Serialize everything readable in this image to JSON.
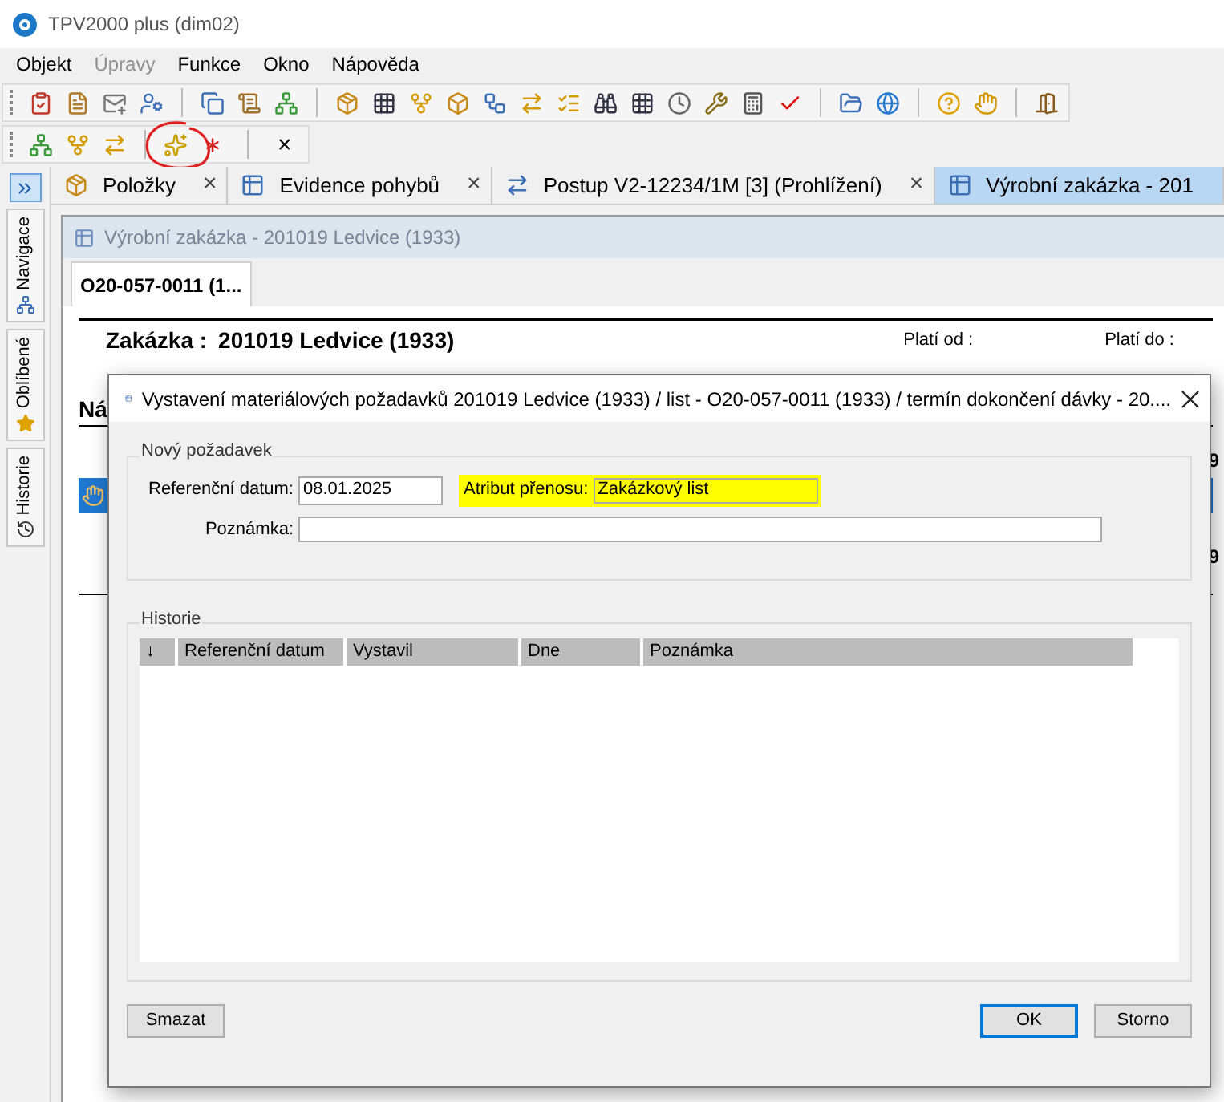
{
  "window": {
    "title": "TPV2000 plus (dim02)"
  },
  "menu": [
    {
      "label": "Objekt",
      "disabled": false
    },
    {
      "label": "Úpravy",
      "disabled": true
    },
    {
      "label": "Funkce",
      "disabled": false
    },
    {
      "label": "Okno",
      "disabled": false
    },
    {
      "label": "Nápověda",
      "disabled": false
    }
  ],
  "toolbar2_close": "×",
  "tabs": [
    {
      "label": "Položky",
      "selected": false,
      "close": "×"
    },
    {
      "label": "Evidence pohybů",
      "selected": false,
      "close": "×"
    },
    {
      "label": "Postup V2-12234/1M  [3] (Prohlížení)",
      "selected": false,
      "close": "×"
    },
    {
      "label": "Výrobní zakázka - 201",
      "selected": true
    }
  ],
  "sidebar": {
    "items": [
      "Navigace",
      "Oblíbené",
      "Historie"
    ]
  },
  "document": {
    "title": "Výrobní zakázka - 201019 Ledvice (1933)",
    "tab": "O20-057-0011 (1...",
    "header_label": "Zakázka :",
    "header_value": "201019 Ledvice (1933)",
    "valid_from": "Platí od :",
    "valid_to": "Platí do :",
    "row_label": "Ná",
    "values": [
      "9",
      "9"
    ]
  },
  "dialog": {
    "title": "Vystavení materiálových požadavků 201019 Ledvice (1933) / list - O20-057-0011 (1933) / termín dokončení dávky - 20....",
    "new_group": "Nový požadavek",
    "ref_date": {
      "label": "Referenční datum:",
      "value": "08.01.2025"
    },
    "attribute": {
      "label": "Atribut přenosu:",
      "value": "Zakázkový list",
      "highlighted": true
    },
    "note": {
      "label": "Poznámka:"
    },
    "history": {
      "title": "Historie",
      "columns": [
        "↓",
        "Referenční datum",
        "Vystavil",
        "Dne",
        "Poznámka"
      ]
    },
    "buttons": [
      {
        "label": "Smazat",
        "default": false
      },
      {
        "label": "OK",
        "default": true
      },
      {
        "label": "Storno",
        "default": false
      }
    ]
  }
}
